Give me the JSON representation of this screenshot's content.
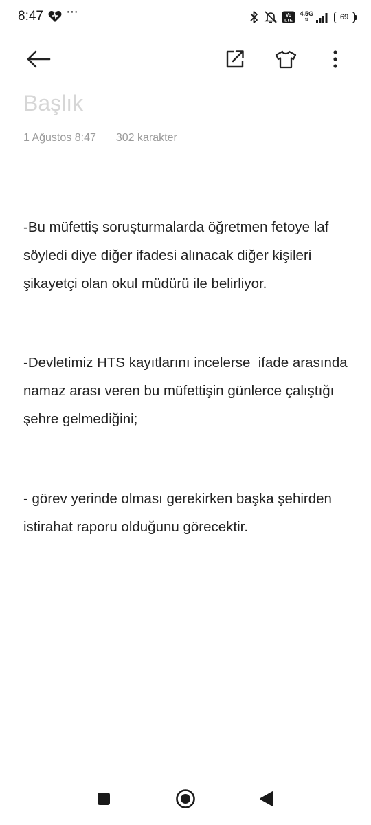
{
  "status_bar": {
    "time": "8:47",
    "network": "4.5G",
    "volte": "Vo LTE",
    "battery": "69",
    "icons": [
      "heart-app-icon",
      "more-notifications-icon",
      "bluetooth-icon",
      "bell-off-icon",
      "volte-icon",
      "signal-icon",
      "battery-icon"
    ]
  },
  "toolbar": {
    "icons": [
      "back-arrow-icon",
      "share-icon",
      "shirt-theme-icon",
      "more-vertical-icon"
    ]
  },
  "note": {
    "title_placeholder": "Başlık",
    "date": "1 Ağustos 8:47",
    "char_count": "302 karakter",
    "paragraphs": [
      "-Bu müfettiş soruşturmalarda öğretmen fetoye laf söyledi diye diğer ifadesi alınacak diğer kişileri şikayetçi olan okul müdürü ile belirliyor.",
      "-Devletimiz HTS kayıtlarını incelerse  ifade arasında namaz arası veren bu müfettişin günlerce çalıştığı şehre gelmediğini;",
      "- görev yerinde olması gerekirken başka şehirden istirahat raporu olduğunu görecektir."
    ]
  },
  "nav_bar": {
    "icons": [
      "recents-square-icon",
      "home-circle-icon",
      "back-triangle-icon"
    ]
  },
  "colors": {
    "text": "#222222",
    "meta": "#9a9a9a",
    "placeholder": "#d6d6d6",
    "background": "#ffffff"
  }
}
